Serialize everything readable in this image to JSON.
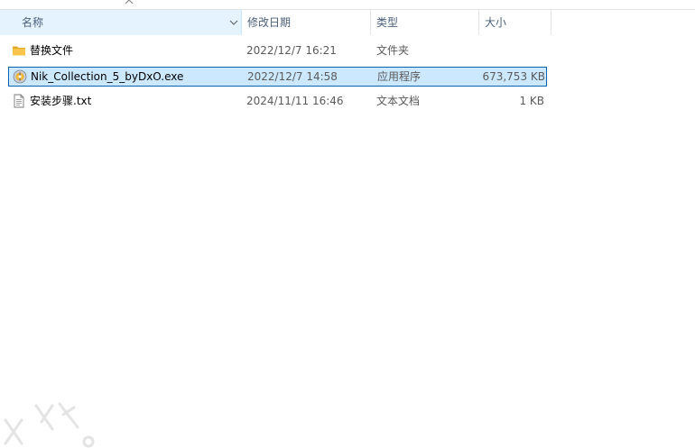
{
  "columns": {
    "name": "名称",
    "date": "修改日期",
    "type": "类型",
    "size": "大小"
  },
  "icons": {
    "sort": "sort-up-icon",
    "column_menu": "chevron-down-icon",
    "folder": "folder-icon",
    "exe": "application-icon",
    "txt": "text-document-icon"
  },
  "files": [
    {
      "name": "替换文件",
      "date": "2022/12/7 16:21",
      "type": "文件夹",
      "size": "",
      "icon": "folder",
      "selected": false
    },
    {
      "name": "Nik_Collection_5_byDxO.exe",
      "date": "2022/12/7 14:58",
      "type": "应用程序",
      "size": "673,753 KB",
      "icon": "exe",
      "selected": true
    },
    {
      "name": "安装步骤.txt",
      "date": "2024/11/11 16:46",
      "type": "文本文档",
      "size": "1 KB",
      "icon": "txt",
      "selected": false
    }
  ],
  "colors": {
    "selection_bg": "#cce8ff",
    "selection_border": "#0063b1",
    "header_text": "#4c607a",
    "folder": "#f8c54a"
  }
}
